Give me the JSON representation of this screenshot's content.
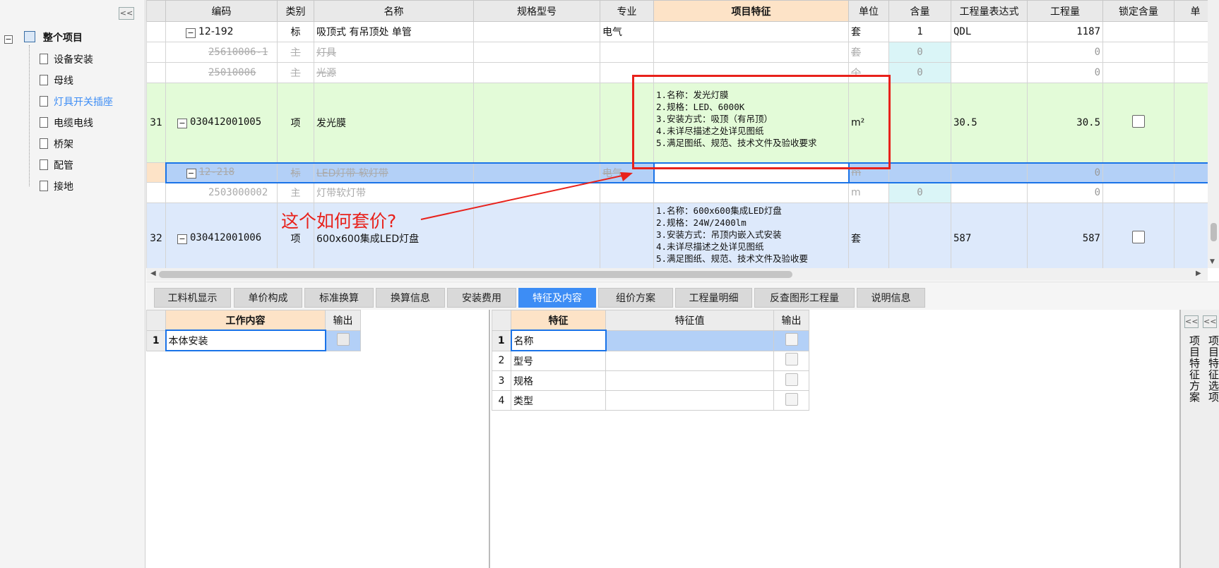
{
  "tree": {
    "collapse": "<<",
    "root": "整个项目",
    "items": [
      "设备安装",
      "母线",
      "灯具开关插座",
      "电缆电线",
      "桥架",
      "配管",
      "接地"
    ],
    "selected_index": 2
  },
  "grid": {
    "headers": [
      "编码",
      "类别",
      "名称",
      "规格型号",
      "专业",
      "项目特征",
      "单位",
      "含量",
      "工程量表达式",
      "工程量",
      "锁定含量",
      "单"
    ],
    "rows": [
      {
        "no": "",
        "code": "12-192",
        "type": "标",
        "name": "吸顶式 有吊顶处 单管",
        "spec": "",
        "major": "电气",
        "feature": "",
        "unit": "套",
        "content": "1",
        "expr": "QDL",
        "qty": "1187",
        "lock": ""
      },
      {
        "no": "",
        "code": "25610006-1",
        "type": "主",
        "name": "灯具",
        "spec": "",
        "major": "",
        "feature": "",
        "unit": "套",
        "content": "0",
        "expr": "",
        "qty": "0",
        "lock": ""
      },
      {
        "no": "",
        "code": "25010006",
        "type": "主",
        "name": "光源",
        "spec": "",
        "major": "",
        "feature": "",
        "unit": "个",
        "content": "0",
        "expr": "",
        "qty": "0",
        "lock": ""
      },
      {
        "no": "31",
        "code": "030412001005",
        "type": "项",
        "name": "发光膜",
        "spec": "",
        "major": "",
        "feature": "1.名称：发光灯膜\n2.规格：LED、6000K\n3.安装方式：吸顶（有吊顶）\n4.未详尽描述之处详见图纸\n5.满足图纸、规范、技术文件及验收要求",
        "unit": "m²",
        "content": "",
        "expr": "30.5",
        "qty": "30.5",
        "lock": ""
      },
      {
        "no": "",
        "code": "12-218",
        "type": "标",
        "name": "LED灯带 软灯带",
        "spec": "",
        "major": "电气",
        "feature": "",
        "unit": "m",
        "content": "",
        "expr": "",
        "qty": "0",
        "lock": ""
      },
      {
        "no": "",
        "code": "2503000002",
        "type": "主",
        "name": "灯带软灯带",
        "spec": "",
        "major": "",
        "feature": "",
        "unit": "m",
        "content": "0",
        "expr": "",
        "qty": "0",
        "lock": ""
      },
      {
        "no": "32",
        "code": "030412001006",
        "type": "项",
        "name": "600x600集成LED灯盘",
        "spec": "",
        "major": "",
        "feature": "1.名称：600x600集成LED灯盘\n2.规格：24W/2400lm\n3.安装方式：吊顶内嵌入式安装\n4.未详尽描述之处详见图纸\n5.满足图纸、规范、技术文件及验收要",
        "unit": "套",
        "content": "",
        "expr": "587",
        "qty": "587",
        "lock": ""
      }
    ],
    "annotation": "这个如何套价?"
  },
  "tabs": [
    "工料机显示",
    "单价构成",
    "标准换算",
    "换算信息",
    "安装费用",
    "特征及内容",
    "组价方案",
    "工程量明细",
    "反查图形工程量",
    "说明信息"
  ],
  "active_tab": "特征及内容",
  "work": {
    "headers": [
      "工作内容",
      "输出"
    ],
    "rows": [
      {
        "no": "1",
        "content": "本体安装"
      }
    ]
  },
  "features": {
    "headers": [
      "特征",
      "特征值",
      "输出"
    ],
    "rows": [
      {
        "no": "1",
        "feature": "名称",
        "value": ""
      },
      {
        "no": "2",
        "feature": "型号",
        "value": ""
      },
      {
        "no": "3",
        "feature": "规格",
        "value": ""
      },
      {
        "no": "4",
        "feature": "类型",
        "value": ""
      }
    ]
  },
  "side_panels": {
    "collapse1": "<<",
    "collapse2": "<<",
    "scheme": "项目特征方案",
    "options": "项目特征选项"
  },
  "colors": {
    "accent": "#3d8df5",
    "highlight_header": "#fde3c7",
    "row_green": "#e3fbd8",
    "row_blue": "#dde9fb",
    "selected_row": "#b3d0f7",
    "annotation": "#e8211b"
  }
}
